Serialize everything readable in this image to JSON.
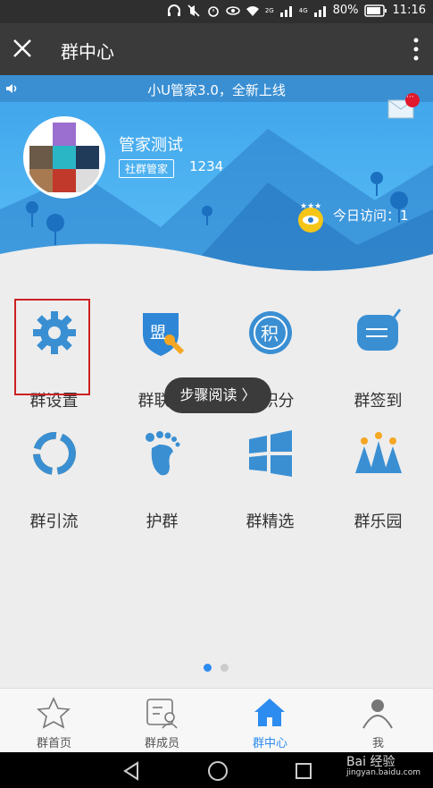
{
  "status_bar": {
    "battery": "80%",
    "time": "11:16",
    "sig1": "2G",
    "sig2": "4G"
  },
  "app_bar": {
    "title": "群中心"
  },
  "notice": {
    "text": "小U管家3.0，全新上线",
    "mail_badge": "···"
  },
  "profile": {
    "name": "管家测试",
    "role_badge": "社群管家",
    "number": "1234",
    "visits": "今日访问：1"
  },
  "grid": {
    "items": [
      {
        "label": "群设置"
      },
      {
        "label": "群联盟"
      },
      {
        "label": "群积分"
      },
      {
        "label": "群签到"
      },
      {
        "label": "群引流"
      },
      {
        "label": "护群"
      },
      {
        "label": "群精选"
      },
      {
        "label": "群乐园"
      }
    ],
    "icon_text_mng": "盟",
    "icon_text_points": "积"
  },
  "toast": {
    "text": "步骤阅读 〉"
  },
  "pagination": {
    "pages": 2,
    "current": 1
  },
  "tabs": [
    {
      "label": "群首页",
      "active": false
    },
    {
      "label": "群成员",
      "active": false
    },
    {
      "label": "群中心",
      "active": true
    },
    {
      "label": "我",
      "active": false
    }
  ],
  "watermark": {
    "text": "Bai 经验",
    "sub": "jingyan.baidu.com"
  },
  "colors": {
    "accent": "#2d8cf0",
    "hero": "#4aaeee",
    "highlight": "#cc2222"
  }
}
